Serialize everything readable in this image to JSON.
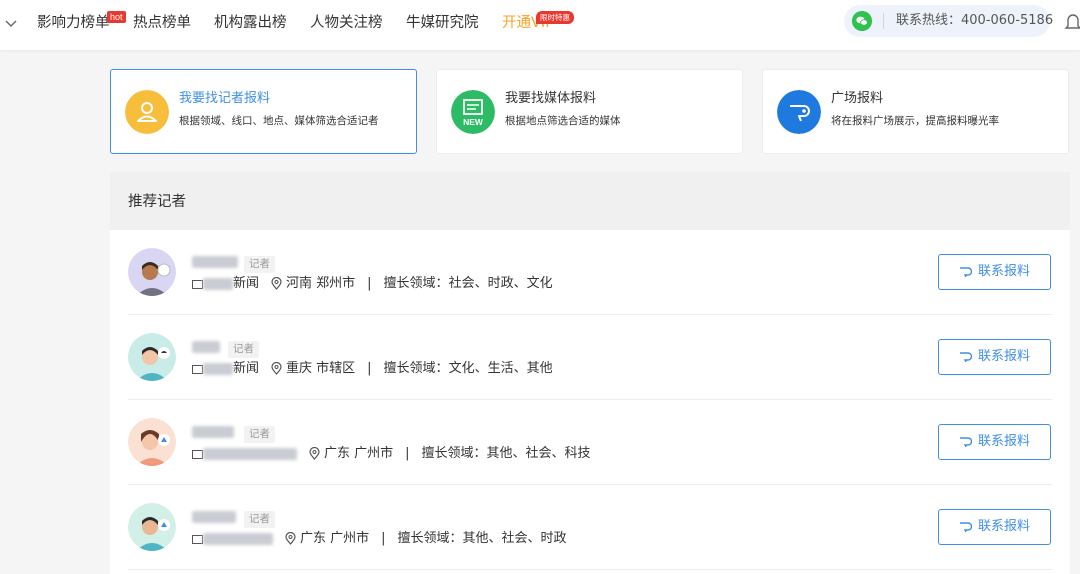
{
  "colors": {
    "accent": "#3f8fe6",
    "vip": "#f5a524",
    "badge": "#e8392f",
    "wechat": "#2fc24f",
    "journalist_card": "#f7be3b",
    "media_card": "#2dbc65",
    "square_card": "#1f7ae0"
  },
  "nav": {
    "items": [
      {
        "label": "影响力榜单",
        "badge": "hot"
      },
      {
        "label": "热点榜单"
      },
      {
        "label": "机构露出榜"
      },
      {
        "label": "人物关注榜"
      },
      {
        "label": "牛媒研究院"
      },
      {
        "label": "开通VIP",
        "badge": "限时特惠"
      }
    ],
    "hotline": "联系热线：400-060-5186"
  },
  "cards": [
    {
      "title": "我要找记者报料",
      "desc": "根据领域、线口、地点、媒体筛选合适记者",
      "icon": "person-icon"
    },
    {
      "title": "我要找媒体报料",
      "desc": "根据地点筛选合适的媒体",
      "icon": "new-media-icon",
      "icon_text": "NEW"
    },
    {
      "title": "广场报料",
      "desc": "将在报料广场展示，提高报料曝光率",
      "icon": "megaphone-icon"
    }
  ],
  "section": {
    "title": "推荐记者"
  },
  "journalists": [
    {
      "role": "记者",
      "org_suffix": "新闻",
      "location": "河南 郑州市",
      "fields_label": "擅长领域：",
      "fields": "社会、时政、文化",
      "button": "联系报料"
    },
    {
      "role": "记者",
      "org_suffix": "新闻",
      "location": "重庆 市辖区",
      "fields_label": "擅长领域：",
      "fields": "文化、生活、其他",
      "button": "联系报料"
    },
    {
      "role": "记者",
      "org_suffix": "",
      "location": "广东 广州市",
      "fields_label": "擅长领域：",
      "fields": "其他、社会、科技",
      "button": "联系报料"
    },
    {
      "role": "记者",
      "org_suffix": "",
      "location": "广东 广州市",
      "fields_label": "擅长领域：",
      "fields": "其他、社会、时政",
      "button": "联系报料"
    }
  ]
}
